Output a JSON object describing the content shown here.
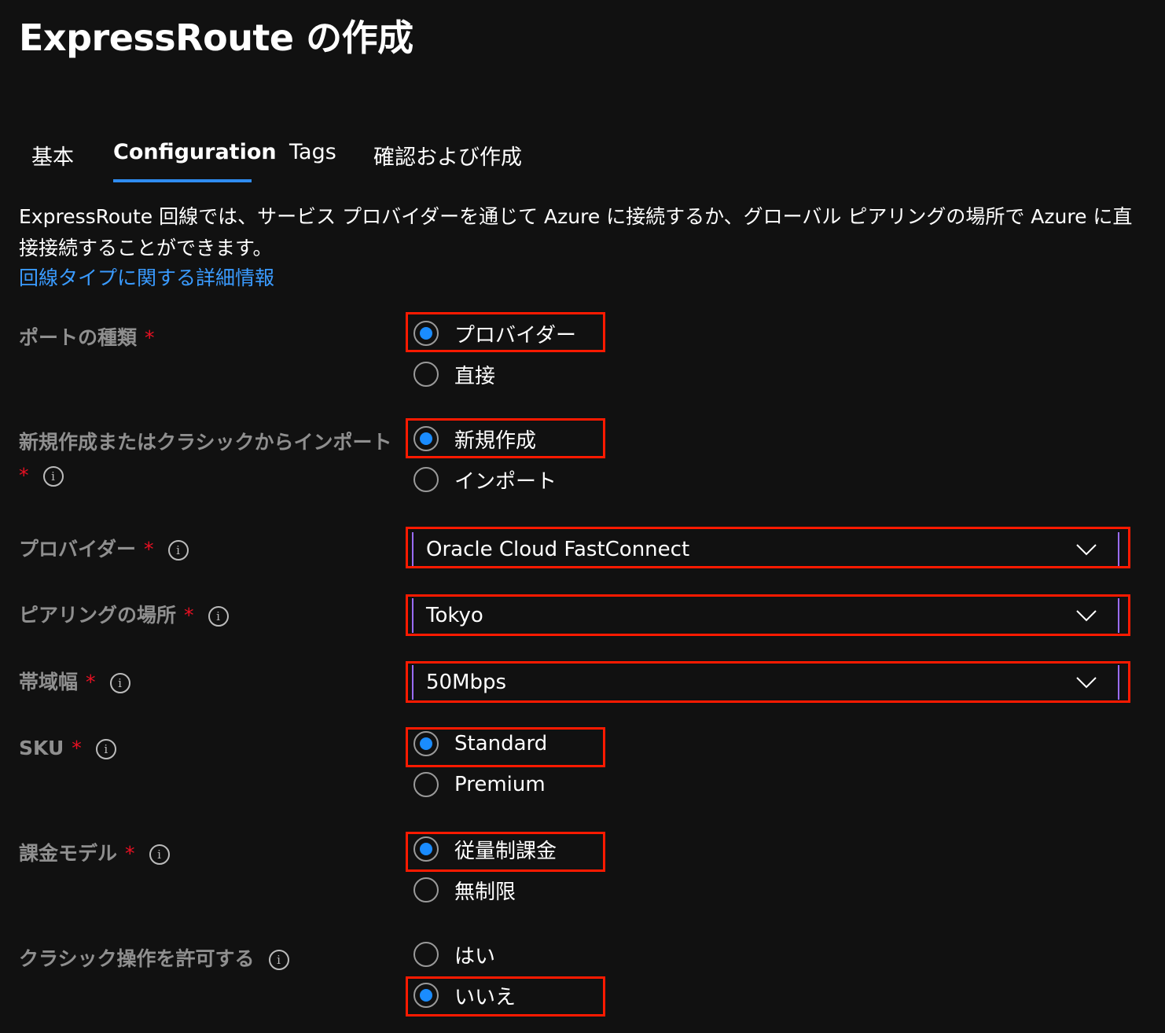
{
  "page": {
    "title": "ExpressRoute の作成"
  },
  "tabs": [
    {
      "label": "基本",
      "active": false
    },
    {
      "label": "Configuration",
      "active": true
    },
    {
      "label": "Tags",
      "active": false
    },
    {
      "label": "確認および作成",
      "active": false
    }
  ],
  "intro": {
    "description": "ExpressRoute 回線では、サービス プロバイダーを通じて Azure に接続するか、グローバル ピアリングの場所で Azure に直接接続することができます。",
    "link_text": "回線タイプに関する詳細情報"
  },
  "required_mark": "*",
  "info_glyph": "i",
  "fields": {
    "port_type": {
      "label": "ポートの種類",
      "options": [
        {
          "label": "プロバイダー",
          "checked": true
        },
        {
          "label": "直接",
          "checked": false
        }
      ]
    },
    "create_or_import": {
      "label": "新規作成またはクラシックからインポート",
      "options": [
        {
          "label": "新規作成",
          "checked": true
        },
        {
          "label": "インポート",
          "checked": false
        }
      ]
    },
    "provider": {
      "label": "プロバイダー",
      "value": "Oracle Cloud FastConnect"
    },
    "peering_location": {
      "label": "ピアリングの場所",
      "value": "Tokyo"
    },
    "bandwidth": {
      "label": "帯域幅",
      "value": "50Mbps"
    },
    "sku": {
      "label": "SKU",
      "options": [
        {
          "label": "Standard",
          "checked": true
        },
        {
          "label": "Premium",
          "checked": false
        }
      ]
    },
    "billing_model": {
      "label": "課金モデル",
      "options": [
        {
          "label": "従量制課金",
          "checked": true
        },
        {
          "label": "無制限",
          "checked": false
        }
      ]
    },
    "allow_classic": {
      "label": "クラシック操作を許可する",
      "options": [
        {
          "label": "はい",
          "checked": false
        },
        {
          "label": "いいえ",
          "checked": true
        }
      ]
    }
  },
  "colors": {
    "background": "#111111",
    "accent": "#2f8cf0",
    "radio_checked": "#1a8cff",
    "highlight": "#ff1a00",
    "required": "#e81123",
    "link": "#3a9bff"
  }
}
